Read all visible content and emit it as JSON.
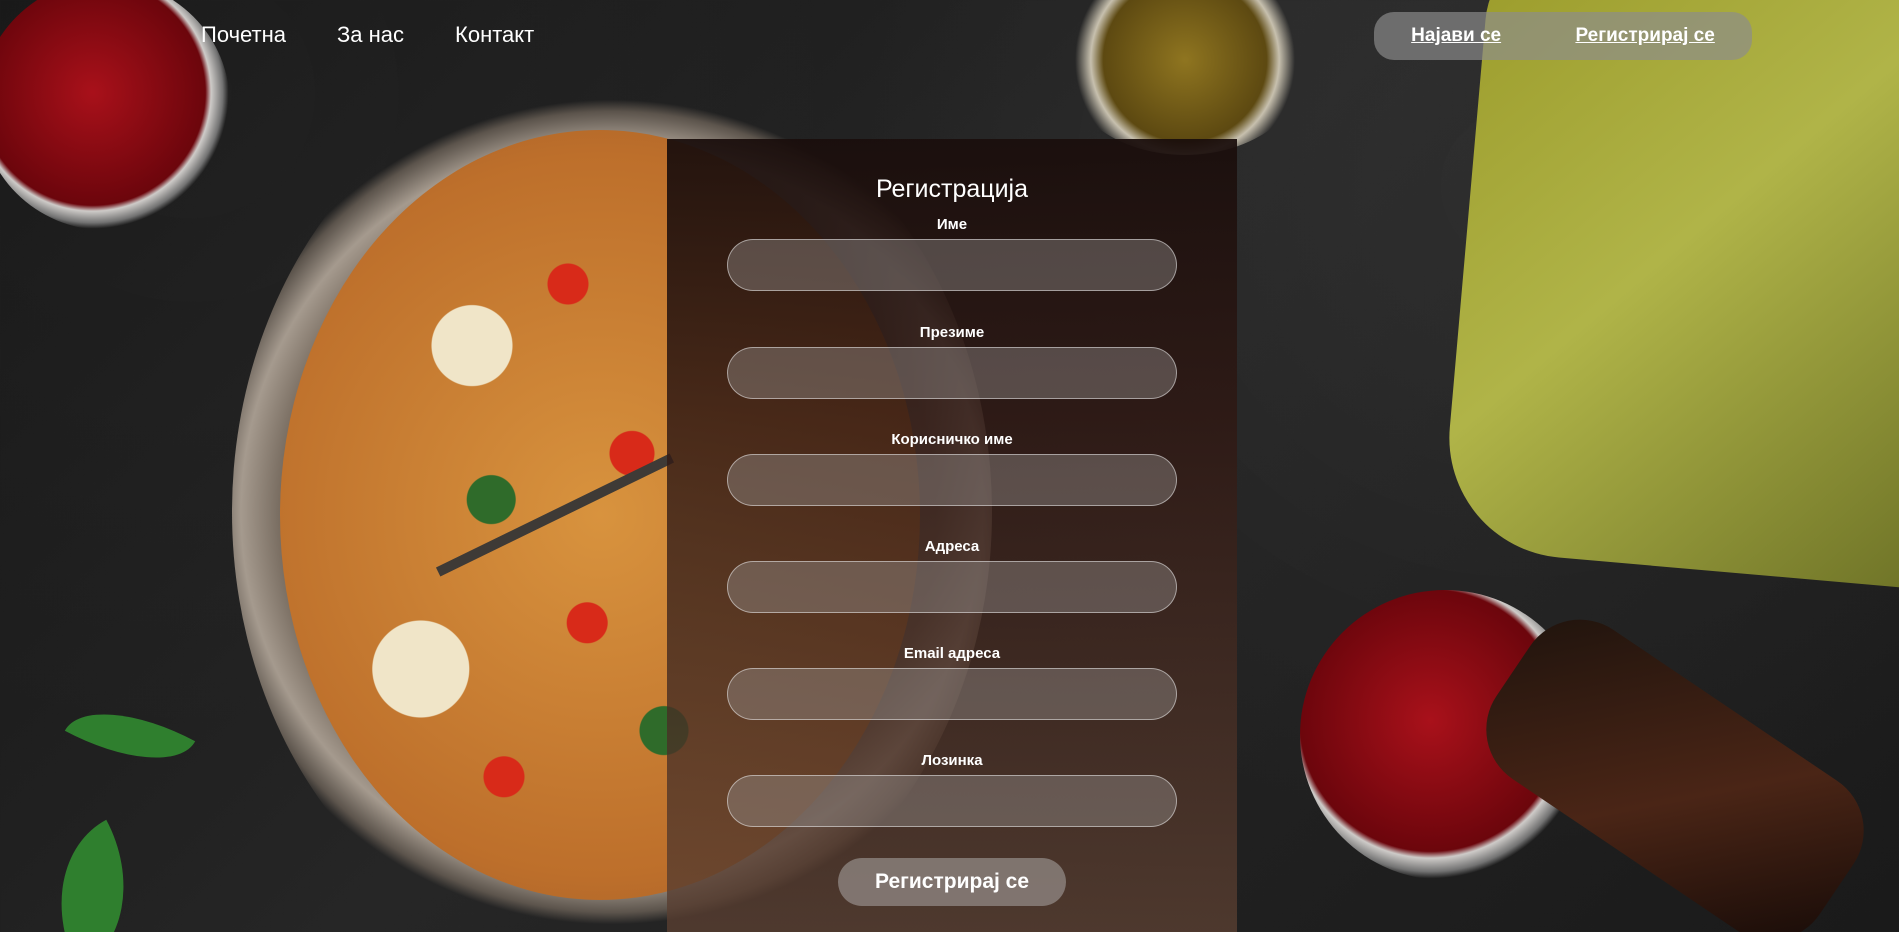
{
  "nav": {
    "home": "Почетна",
    "about": "За нас",
    "contact": "Контакт"
  },
  "auth": {
    "login": "Најави се",
    "register": "Регистрирај се"
  },
  "form": {
    "title": "Регистрација",
    "fields": [
      {
        "label": "Име",
        "value": "",
        "placeholder": ""
      },
      {
        "label": "Презиме",
        "value": "",
        "placeholder": ""
      },
      {
        "label": "Корисничко име",
        "value": "",
        "placeholder": ""
      },
      {
        "label": "Адреса",
        "value": "",
        "placeholder": ""
      },
      {
        "label": "Email адреса",
        "value": "",
        "placeholder": ""
      },
      {
        "label": "Лозинка",
        "value": "",
        "placeholder": ""
      }
    ],
    "submit": "Регистрирај се"
  },
  "colors": {
    "nav_button_bg": "#8c8c8c",
    "card_top": "#1a0e0c",
    "card_bottom": "#5b4032",
    "input_bg": "#96918e",
    "text": "#ffffff"
  }
}
